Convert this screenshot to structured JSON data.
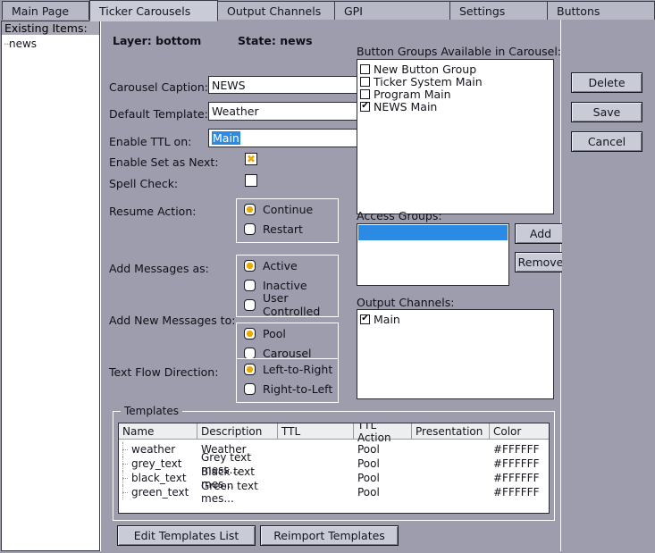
{
  "tabs": [
    {
      "label": "Main Page",
      "active": false
    },
    {
      "label": "Ticker Carousels",
      "active": true
    },
    {
      "label": "Output Channels",
      "active": false
    },
    {
      "label": "GPI",
      "active": false
    },
    {
      "label": "Settings",
      "active": false
    },
    {
      "label": "Buttons",
      "active": false
    }
  ],
  "sidebar": {
    "title": "Existing Items:",
    "items": [
      {
        "label": "news"
      }
    ]
  },
  "header": {
    "layer": "Layer: bottom",
    "state": "State: news"
  },
  "form": {
    "carousel_caption_label": "Carousel Caption:",
    "carousel_caption_value": "NEWS",
    "default_template_label": "Default Template:",
    "default_template_value": "Weather",
    "enable_ttl_label": "Enable TTL on:",
    "enable_ttl_value": "Main",
    "enable_set_as_next_label": "Enable Set as Next:",
    "spell_check_label": "Spell Check:",
    "resume_action_label": "Resume Action:",
    "resume_action_options": [
      {
        "label": "Continue",
        "selected": true
      },
      {
        "label": "Restart",
        "selected": false
      }
    ],
    "add_messages_as_label": "Add Messages as:",
    "add_messages_as_options": [
      {
        "label": "Active",
        "selected": true
      },
      {
        "label": "Inactive",
        "selected": false
      },
      {
        "label": "User Controlled",
        "selected": false
      }
    ],
    "add_new_messages_to_label": "Add New Messages to:",
    "add_new_messages_to_options": [
      {
        "label": "Pool",
        "selected": true
      },
      {
        "label": "Carousel",
        "selected": false
      }
    ],
    "text_flow_direction_label": "Text Flow Direction:",
    "text_flow_direction_options": [
      {
        "label": "Left-to-Right",
        "selected": true
      },
      {
        "label": "Right-to-Left",
        "selected": false
      }
    ]
  },
  "button_groups": {
    "label": "Button Groups Available in Carousel:",
    "items": [
      {
        "label": "New Button Group",
        "checked": false
      },
      {
        "label": "Ticker System Main",
        "checked": false
      },
      {
        "label": "Program Main",
        "checked": false
      },
      {
        "label": "NEWS Main",
        "checked": true
      }
    ]
  },
  "access_groups": {
    "label": "Access Groups:",
    "items": [],
    "add_label": "Add",
    "remove_label": "Remove"
  },
  "output_channels": {
    "label": "Output Channels:",
    "items": [
      {
        "label": "Main",
        "checked": true
      }
    ]
  },
  "actions": {
    "delete_label": "Delete",
    "save_label": "Save",
    "cancel_label": "Cancel"
  },
  "templates": {
    "legend": "Templates",
    "columns": [
      "Name",
      "Description",
      "TTL",
      "TTL Action",
      "Presentation",
      "Color"
    ],
    "rows": [
      {
        "name": "weather",
        "description": "Weather",
        "ttl": "",
        "ttl_action": "Pool",
        "presentation": "",
        "color": "#FFFFFF"
      },
      {
        "name": "grey_text",
        "description": "Grey text mess...",
        "ttl": "",
        "ttl_action": "Pool",
        "presentation": "",
        "color": "#FFFFFF"
      },
      {
        "name": "black_text",
        "description": "Black text mes...",
        "ttl": "",
        "ttl_action": "Pool",
        "presentation": "",
        "color": "#FFFFFF"
      },
      {
        "name": "green_text",
        "description": "Green text mes...",
        "ttl": "",
        "ttl_action": "Pool",
        "presentation": "",
        "color": "#FFFFFF"
      }
    ],
    "edit_templates_label": "Edit Templates List",
    "reimport_templates_label": "Reimport Templates"
  },
  "checkmark": "✔",
  "xmark": "✖"
}
